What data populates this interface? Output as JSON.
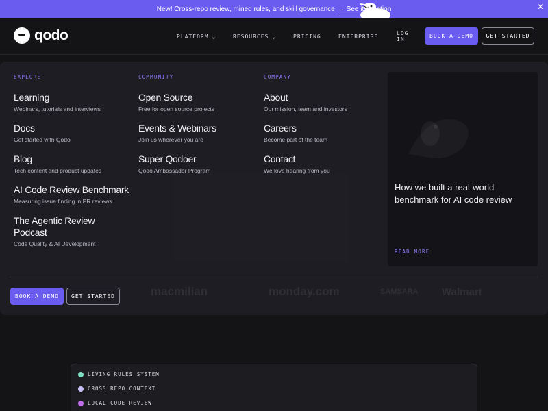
{
  "banner": {
    "text": "New! Cross-repo review, mined rules, and skill governance",
    "cta": "→ See it in action",
    "close": "✕"
  },
  "nav": {
    "logo": "qodo",
    "items": [
      {
        "label": "PLATFORM",
        "has_dropdown": true
      },
      {
        "label": "RESOURCES",
        "has_dropdown": true
      },
      {
        "label": "PRICING"
      },
      {
        "label": "ENTERPRISE"
      },
      {
        "label": "LOG IN"
      }
    ],
    "book_demo": "BOOK A DEMO",
    "get_started": "GET STARTED",
    "chevron": "⌄"
  },
  "dropdown": {
    "explore": {
      "heading": "EXPLORE",
      "items": [
        {
          "title": "Learning",
          "desc": "Webinars, tutorials and interviews"
        },
        {
          "title": "Docs",
          "desc": "Get started with Qodo"
        },
        {
          "title": "Blog",
          "desc": "Tech content and product updates"
        },
        {
          "title": "AI Code Review Benchmark",
          "desc": "Measuring issue finding in PR reviews"
        },
        {
          "title": "The Agentic Review Podcast",
          "desc": "Code Quality & AI Development"
        }
      ]
    },
    "community": {
      "heading": "COMMUNITY",
      "items": [
        {
          "title": "Open Source",
          "desc": "Free for open source projects"
        },
        {
          "title": "Events & Webinars",
          "desc": "Join us wherever you are"
        },
        {
          "title": "Super Qodoer",
          "desc": "Qodo Ambassador Program"
        }
      ]
    },
    "company": {
      "heading": "COMPANY",
      "items": [
        {
          "title": "About",
          "desc": "Our mission, team and investors"
        },
        {
          "title": "Careers",
          "desc": "Become part of the team"
        },
        {
          "title": "Contact",
          "desc": "We love hearing from you"
        }
      ]
    },
    "feature_card": {
      "headline": "How we built a real-world benchmark for AI code review",
      "cta": "READ MORE"
    },
    "book_demo": "BOOK A DEMO",
    "get_started": "GET STARTED"
  },
  "background_logos": [
    "macmillan",
    "monday.com",
    "SAMSARA",
    "Walmart"
  ],
  "features": [
    {
      "label": "LIVING RULES SYSTEM",
      "color": "#7ee0c0"
    },
    {
      "label": "CROSS REPO CONTEXT",
      "color": "#c8c0f8"
    },
    {
      "label": "LOCAL CODE REVIEW",
      "color": "#c070e8"
    }
  ],
  "colors": {
    "accent": "#6b5cf0",
    "heading_purple": "#8b7cf6",
    "background": "#141417",
    "panel": "#1e1e24"
  }
}
